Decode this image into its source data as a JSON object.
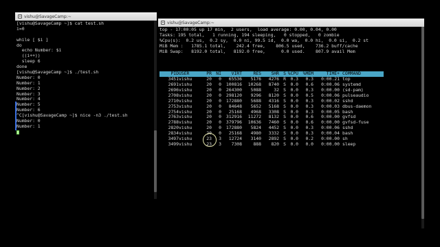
{
  "left_window": {
    "title": "vishu@SavageCamp:~",
    "lines": [
      "[vishu@SavageCamp ~]$ cat test.sh",
      "i=0",
      "",
      "while [ $i ]",
      "do",
      "  echo Number: $i",
      "  ((i++))",
      "  sleep 6",
      "done",
      "[vishu@SavageCamp ~]$ ./test.sh",
      "Number: 0",
      "Number: 1",
      "Number: 2",
      "Number: 3",
      "Number: 4",
      "Number: 5",
      "Number: 6",
      "^C[vishu@SavageCamp ~]$ nice -n3 ./test.sh",
      "Number: 0",
      "Number: 1"
    ]
  },
  "right_window": {
    "title": "vishu@SavageCamp:~",
    "summary": [
      "top - 17:00:05 up 17 min,  2 users,  load average: 0.00, 0.04, 0.00",
      "Tasks: 195 total,   1 running, 194 sleeping,   0 stopped,   0 zombie",
      "%Cpu(s):  0.2 us,  0.2 sy,  0.0 ni, 99.5 id,  0.0 wa,  0.0 hi,  0.0 si,  0.2 st",
      "MiB Mem :   1785.1 total,    242.4 free,    806.5 used,    736.2 buff/cache",
      "MiB Swap:   8192.0 total,   8192.0 free,      0.0 used.    807.9 avail Mem"
    ],
    "columns": [
      "PID",
      "USER",
      "PR",
      "NI",
      "VIRT",
      "RES",
      "SHR",
      "S",
      "%CPU",
      "%MEM",
      "TIME+",
      "COMMAND"
    ],
    "rows": [
      [
        "3451",
        "vishu",
        "20",
        "0",
        "65536",
        "5176",
        "4276",
        "R",
        "0.3",
        "0.3",
        "0:00.21",
        "top"
      ],
      [
        "2691",
        "vishu",
        "20",
        "0",
        "100816",
        "10268",
        "8740",
        "S",
        "0.0",
        "0.6",
        "0:00.06",
        "systemd"
      ],
      [
        "2696",
        "vishu",
        "20",
        "0",
        "264300",
        "5088",
        "32",
        "S",
        "0.0",
        "0.3",
        "0:00.00",
        "(sd-pam)"
      ],
      [
        "2708",
        "vishu",
        "20",
        "0",
        "298120",
        "9296",
        "8120",
        "S",
        "0.0",
        "0.5",
        "0:00.06",
        "pulseaudio"
      ],
      [
        "2710",
        "vishu",
        "20",
        "0",
        "172880",
        "5688",
        "4316",
        "S",
        "0.0",
        "0.3",
        "0:00.02",
        "sshd"
      ],
      [
        "2753",
        "vishu",
        "20",
        "0",
        "84648",
        "5652",
        "5168",
        "S",
        "0.0",
        "0.3",
        "0:00.03",
        "dbus-daemon"
      ],
      [
        "2754",
        "vishu",
        "20",
        "0",
        "25168",
        "4968",
        "3308",
        "S",
        "0.0",
        "0.3",
        "0:00.05",
        "bash"
      ],
      [
        "2763",
        "vishu",
        "20",
        "0",
        "312916",
        "11272",
        "8132",
        "S",
        "0.0",
        "0.6",
        "0:00.00",
        "gvfsd"
      ],
      [
        "2788",
        "vishu",
        "20",
        "0",
        "379796",
        "10636",
        "7460",
        "S",
        "0.0",
        "0.6",
        "0:00.00",
        "gvfsd-fuse"
      ],
      [
        "2820",
        "vishu",
        "20",
        "0",
        "172880",
        "5824",
        "4452",
        "S",
        "0.0",
        "0.3",
        "0:00.06",
        "sshd"
      ],
      [
        "2834",
        "vishu",
        "20",
        "0",
        "25168",
        "4980",
        "3332",
        "S",
        "0.0",
        "0.3",
        "0:00.04",
        "bash"
      ],
      [
        "3497",
        "vishu",
        "23",
        "3",
        "12724",
        "3140",
        "2892",
        "S",
        "0.0",
        "0.2",
        "0:00.00",
        "sh"
      ],
      [
        "3499",
        "vishu",
        "23",
        "3",
        "7308",
        "888",
        "820",
        "S",
        "0.0",
        "0.0",
        "0:00.00",
        "sleep"
      ]
    ]
  },
  "colors": {
    "header_bg": "#4aa6c6",
    "cursor": "#b8f2a4",
    "selection": "#3a6fe0"
  }
}
